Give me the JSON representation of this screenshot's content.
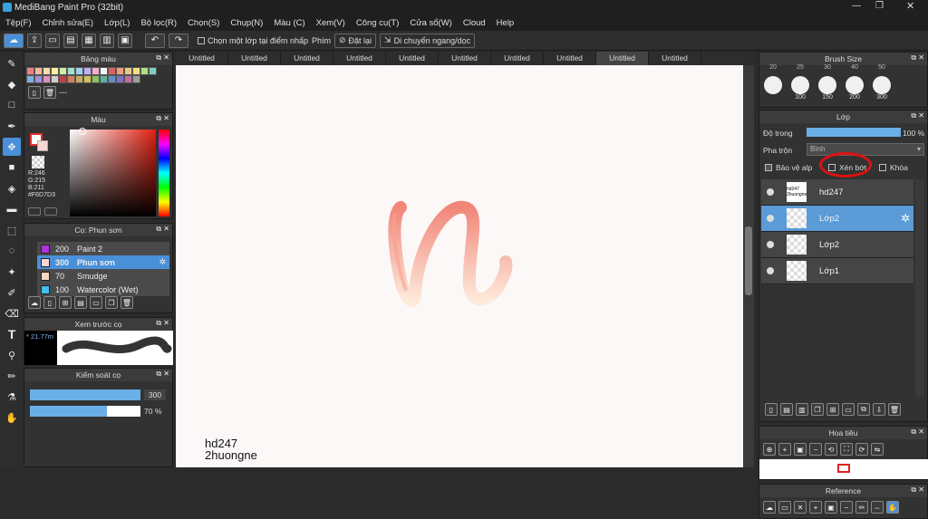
{
  "app": {
    "title": "MediBang Paint Pro (32bit)"
  },
  "menu": [
    "Tệp(F)",
    "Chỉnh sửa(E)",
    "Lớp(L)",
    "Bộ lọc(R)",
    "Chọn(S)",
    "Chụp(N)",
    "Màu (C)",
    "Xem(V)",
    "Công cụ(T)",
    "Cửa sổ(W)",
    "Cloud",
    "Help"
  ],
  "toolbar": {
    "select_layer_label": "Chọn một lớp tại điểm nhấp",
    "key_label": "Phím",
    "reset_label": "Đặt lại",
    "move_label": "Di chuyển ngang/dọc"
  },
  "tabs": [
    "Untitled",
    "Untitled",
    "Untitled",
    "Untitled",
    "Untitled",
    "Untitled",
    "Untitled",
    "Untitled",
    "Untitled",
    "Untitled"
  ],
  "active_tab_index": 8,
  "palette": {
    "title": "Bảng màu",
    "selected_value": "---",
    "colors": [
      "#f08080",
      "#ffb6a0",
      "#ffdca0",
      "#fff0a0",
      "#d0f0a0",
      "#a0e0d0",
      "#a0d0f0",
      "#c0b0f0",
      "#f0b0d0",
      "#f8f8f8",
      "#e06060",
      "#f0a080",
      "#e8c880",
      "#f0e080",
      "#b0e080",
      "#80d0c0",
      "#80b0e0",
      "#a090e0",
      "#e090c0",
      "#cfcfcf",
      "#c04040",
      "#d08060",
      "#c8a860",
      "#d0c060",
      "#90c060",
      "#60b0a0",
      "#6090c0",
      "#8070c0",
      "#c070a0",
      "#9e9e9e"
    ]
  },
  "color_panel": {
    "title": "Màu",
    "r": "R:246",
    "g": "G:215",
    "b": "B:211",
    "hex": "#F6D7D3",
    "primary": "#f6d7d3"
  },
  "brush_panel": {
    "title": "Cọ: Phun sơn",
    "items": [
      {
        "size": "200",
        "name": "Paint 2",
        "color": "#b030e0"
      },
      {
        "size": "300",
        "name": "Phun sơn",
        "color": "#f6d7d3"
      },
      {
        "size": "70",
        "name": "Smudge",
        "color": "#f8d8c0"
      },
      {
        "size": "100",
        "name": "Watercolor (Wet)",
        "color": "#40c0f0"
      }
    ],
    "selected_index": 1
  },
  "preview_panel": {
    "title": "Xem trước cọ",
    "size_label": "21.77"
  },
  "brush_control": {
    "title": "Kiểm soát cọ",
    "size_value": "300",
    "opacity_value": "70 %",
    "opacity": 0.7
  },
  "brush_size": {
    "title": "Brush Size",
    "top_labels": [
      "20",
      "25",
      "30",
      "40",
      "50"
    ],
    "sizes": [
      "100",
      "150",
      "200",
      "300"
    ]
  },
  "layer_panel": {
    "title": "Lớp",
    "opacity_label": "Độ trong",
    "opacity_value": "100 %",
    "blend_label": "Pha trộn",
    "blend_value": "Bình",
    "protect_label": "Bảo vệ alp",
    "clip_label": "Xén bớt",
    "lock_label": "Khóa",
    "layers": [
      "hd247",
      "Lớp2",
      "Lớp2",
      "Lớp1"
    ],
    "selected_index": 1
  },
  "navigator": {
    "title": "Hoa tiêu"
  },
  "reference": {
    "title": "Reference"
  },
  "watermark": {
    "line1": "hd247",
    "line2": "2huongne"
  },
  "accent": "#4a90d9",
  "annotation_color": "#e01010"
}
